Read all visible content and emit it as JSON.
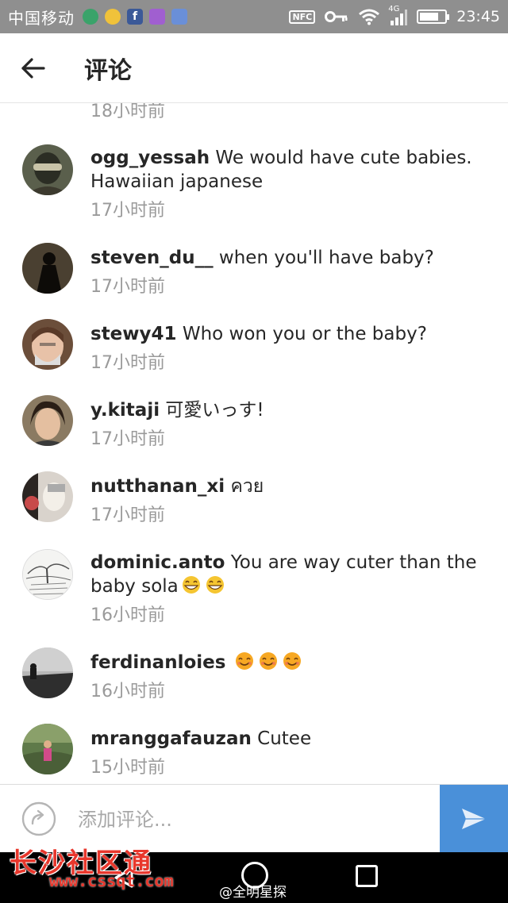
{
  "status_bar": {
    "carrier": "中国移动",
    "nfc": "NFC",
    "network": "4G",
    "time": "23:45",
    "battery_level": 0.75
  },
  "header": {
    "title": "评论",
    "back_icon": "arrow-left-icon"
  },
  "cut_off_time": "18小时前",
  "comments": [
    {
      "username": "ogg_yessah",
      "text": "We would have cute babies. Hawaiian japanese",
      "time": "17小时前",
      "emojis": []
    },
    {
      "username": "steven_du__",
      "text": "when you'll have baby?",
      "time": "17小时前",
      "emojis": []
    },
    {
      "username": "stewy41",
      "text": "Who won you or the  baby?",
      "time": "17小时前",
      "emojis": []
    },
    {
      "username": "y.kitaji",
      "text": "可愛いっす!",
      "time": "17小时前",
      "emojis": []
    },
    {
      "username": "nutthanan_xi",
      "text": "ควย",
      "time": "17小时前",
      "emojis": []
    },
    {
      "username": "dominic.anto",
      "text": "You are way cuter than the baby sola",
      "time": "16小时前",
      "emojis": [
        "grinning-face",
        "grinning-face"
      ]
    },
    {
      "username": "ferdinanloies",
      "text": "",
      "time": "16小时前",
      "emojis": [
        "smiling-face",
        "smiling-face",
        "smiling-face"
      ]
    },
    {
      "username": "mranggafauzan",
      "text": "Cutee",
      "time": "15小时前",
      "emojis": []
    }
  ],
  "composer": {
    "placeholder": "添加评论...",
    "add_icon": "rotate-arrow-icon",
    "send_icon": "paper-plane-icon"
  },
  "watermarks": {
    "site": "长沙社区通",
    "url": "www.cssqt.com",
    "weibo": "@全明星探"
  },
  "colors": {
    "status_bar": "#8f8f8f",
    "send_button": "#4a90d9",
    "timestamp": "#9a9a9a",
    "watermark": "#e8372c"
  }
}
